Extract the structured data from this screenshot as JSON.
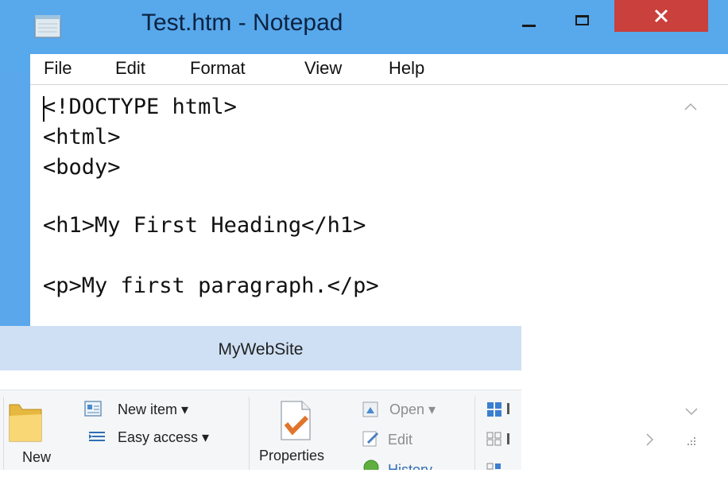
{
  "notepad": {
    "title": "Test.htm - Notepad",
    "window_controls": {
      "minimize_icon": "minimize-icon",
      "maximize_icon": "maximize-icon",
      "close_icon": "close-icon"
    },
    "menu": [
      "File",
      "Edit",
      "Format",
      "View",
      "Help"
    ],
    "lines": [
      "<!DOCTYPE html>",
      "<html>",
      "<body>",
      "",
      "<h1>My First Heading</h1>",
      "",
      "<p>My first paragraph.</p>"
    ]
  },
  "explorer": {
    "title": "MyWebSite",
    "ribbon": {
      "new_label": "New",
      "new_item": "New item ▾",
      "easy_access": "Easy access ▾",
      "properties": "Properties",
      "open": "Open ▾",
      "edit": "Edit",
      "history": "History"
    }
  },
  "colors": {
    "titlebar": "#58a8ec",
    "close_button": "#c9403c",
    "explorer_title": "#cfe0f4"
  }
}
